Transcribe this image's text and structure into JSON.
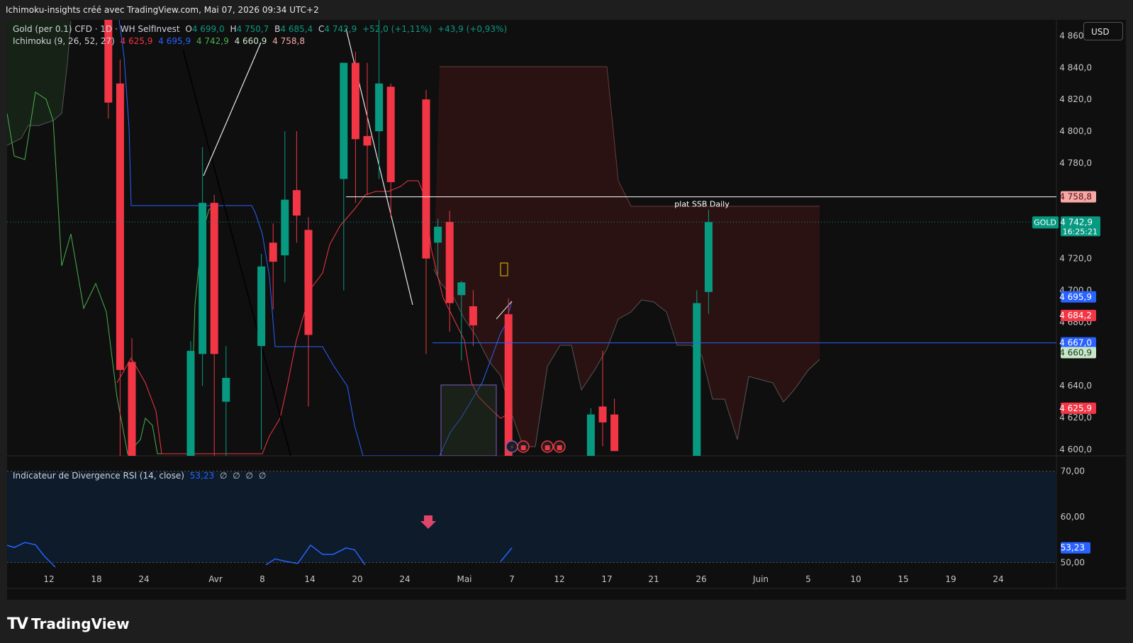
{
  "header": {
    "title": "Ichimoku-insights créé avec TradingView.com, Mai 07, 2026 09:34 UTC+2"
  },
  "legend": {
    "symbol": "Gold (per 0.1) CFD · 1D · WH SelfInvest",
    "ohlc": [
      {
        "key": "O",
        "val": "4 699,0"
      },
      {
        "key": "H",
        "val": "4 750,7"
      },
      {
        "key": "B",
        "val": "4 685,4"
      },
      {
        "key": "C",
        "val": "4 742,9"
      }
    ],
    "change": "+52,0 (+1,11%)",
    "change2": "+43,9 (+0,93%)",
    "ichimoku_label": "Ichimoku (9, 26, 52, 27)",
    "ichimoku_values": [
      {
        "val": "4 625,9",
        "color": "#f23645"
      },
      {
        "val": "4 695,9",
        "color": "#2962ff"
      },
      {
        "val": "4 742,9",
        "color": "#4caf50"
      },
      {
        "val": "4 660,9",
        "color": "#c8e6c9"
      },
      {
        "val": "4 758,8",
        "color": "#f7a9a8"
      }
    ],
    "rsi_label": "Indicateur de Divergence RSI (14, close)",
    "rsi_value": "53,23",
    "rsi_empty": [
      "∅",
      "∅",
      "∅",
      "∅"
    ]
  },
  "currency": "USD",
  "price_axis": {
    "ticks": [
      "4 860,0",
      "4 840,0",
      "4 820,0",
      "4 800,0",
      "4 780,0",
      "4 720,0",
      "4 700,0",
      "4 680,0",
      "4 640,0",
      "4 620,0",
      "4 600,0"
    ],
    "tick_values": [
      4860,
      4840,
      4820,
      4800,
      4780,
      4720,
      4700,
      4680,
      4640,
      4620,
      4600
    ],
    "badges": [
      {
        "text": "4 758,8",
        "value": 4758.8,
        "bg": "#f7a9a8",
        "fg": "#5a1010"
      },
      {
        "text": "4 695,9",
        "value": 4695.9,
        "bg": "#2962ff",
        "fg": "#ffffff"
      },
      {
        "text": "4 684,2",
        "value": 4684.2,
        "bg": "#f23645",
        "fg": "#ffffff"
      },
      {
        "text": "4 667,0",
        "value": 4667.0,
        "bg": "#2962ff",
        "fg": "#ffffff"
      },
      {
        "text": "4 660,9",
        "value": 4660.9,
        "bg": "#c8e6c9",
        "fg": "#1b3a1b"
      },
      {
        "text": "4 625,9",
        "value": 4625.9,
        "bg": "#f23645",
        "fg": "#ffffff"
      }
    ],
    "current": {
      "symbol": "GOLD",
      "price": "4 742,9",
      "value": 4742.9,
      "countdown": "16:25:21",
      "color": "#089981"
    }
  },
  "rsi_axis": {
    "ticks": [
      "70,00",
      "60,00",
      "50,00"
    ],
    "tick_values": [
      70,
      60,
      50
    ],
    "badge": {
      "text": "53,23",
      "value": 53.23,
      "bg": "#2962ff"
    }
  },
  "time_axis": [
    "12",
    "18",
    "24",
    "Avr",
    "8",
    "14",
    "20",
    "24",
    "Mai",
    "7",
    "12",
    "17",
    "21",
    "26",
    "Juin",
    "5",
    "10",
    "15",
    "19",
    "24"
  ],
  "annotation": {
    "text": "plat SSB Daily",
    "value": 4758.8
  },
  "chart_data": {
    "type": "candlestick",
    "symbol": "Gold (per 0.1) CFD",
    "timeframe": "1D",
    "currency": "USD",
    "y_range": [
      4596,
      4870
    ],
    "candles": [
      {
        "date": "2026-03-17",
        "o": 4930,
        "h": 4935,
        "l": 4808,
        "c": 4818
      },
      {
        "date": "2026-03-18",
        "o": 4830,
        "h": 4845,
        "l": 4590,
        "c": 4650
      },
      {
        "date": "2026-03-19",
        "o": 4655,
        "h": 4670,
        "l": 4585,
        "c": 4590
      },
      {
        "date": "2026-03-24",
        "o": 4590,
        "h": 4668,
        "l": 4575,
        "c": 4662
      },
      {
        "date": "2026-03-25",
        "o": 4660,
        "h": 4790,
        "l": 4640,
        "c": 4755
      },
      {
        "date": "2026-03-26",
        "o": 4755,
        "h": 4760,
        "l": 4580,
        "c": 4660
      },
      {
        "date": "2026-03-27",
        "o": 4630,
        "h": 4665,
        "l": 4575,
        "c": 4645
      },
      {
        "date": "2026-03-30",
        "o": 4665,
        "h": 4723,
        "l": 4600,
        "c": 4715
      },
      {
        "date": "2026-03-31",
        "o": 4730,
        "h": 4742,
        "l": 4688,
        "c": 4718
      },
      {
        "date": "2026-04-01",
        "o": 4722,
        "h": 4800,
        "l": 4705,
        "c": 4757
      },
      {
        "date": "2026-04-02",
        "o": 4763,
        "h": 4800,
        "l": 4730,
        "c": 4747
      },
      {
        "date": "2026-04-03",
        "o": 4738,
        "h": 4746,
        "l": 4627,
        "c": 4672
      },
      {
        "date": "2026-04-06",
        "o": 4770,
        "h": 4840,
        "l": 4700,
        "c": 4843
      },
      {
        "date": "2026-04-07",
        "o": 4843,
        "h": 4850,
        "l": 4755,
        "c": 4795
      },
      {
        "date": "2026-04-08",
        "o": 4797,
        "h": 4843,
        "l": 4760,
        "c": 4791
      },
      {
        "date": "2026-04-09",
        "o": 4800,
        "h": 4872,
        "l": 4770,
        "c": 4830
      },
      {
        "date": "2026-04-10",
        "o": 4828,
        "h": 4830,
        "l": 4746,
        "c": 4768
      },
      {
        "date": "2026-04-13",
        "o": 4820,
        "h": 4826,
        "l": 4660,
        "c": 4720
      },
      {
        "date": "2026-04-14",
        "o": 4730,
        "h": 4745,
        "l": 4710,
        "c": 4740
      },
      {
        "date": "2026-04-15",
        "o": 4743,
        "h": 4750,
        "l": 4674,
        "c": 4692
      },
      {
        "date": "2026-04-16",
        "o": 4697,
        "h": 4706,
        "l": 4656,
        "c": 4705
      },
      {
        "date": "2026-04-17",
        "o": 4690,
        "h": 4700,
        "l": 4665,
        "c": 4678
      },
      {
        "date": "2026-04-20",
        "o": 4685,
        "h": 4695,
        "l": 4550,
        "c": 4555
      },
      {
        "date": "2026-04-27",
        "o": 4590,
        "h": 4626,
        "l": 4575,
        "c": 4622
      },
      {
        "date": "2026-04-28",
        "o": 4627,
        "h": 4662,
        "l": 4602,
        "c": 4617
      },
      {
        "date": "2026-04-29",
        "o": 4622,
        "h": 4632,
        "l": 4600,
        "c": 4599
      },
      {
        "date": "2026-05-06",
        "o": 4590,
        "h": 4700,
        "l": 4560,
        "c": 4692
      },
      {
        "date": "2026-05-07",
        "o": 4699,
        "h": 4750.7,
        "l": 4685.4,
        "c": 4742.9
      }
    ],
    "ichimoku": {
      "params": [
        9,
        26,
        52,
        27
      ],
      "tenkan": 4625.9,
      "kijun": 4695.9,
      "chikou": 4742.9,
      "senkou_a": 4660.9,
      "senkou_b": 4758.8
    },
    "horizontal_lines": [
      {
        "label": "plat SSB Daily",
        "value": 4758.8
      },
      {
        "value": 4667.0
      }
    ],
    "rsi": {
      "period": 14,
      "source": "close",
      "value": 53.23,
      "levels": [
        70,
        50
      ],
      "y_range": [
        49,
        78
      ]
    }
  }
}
